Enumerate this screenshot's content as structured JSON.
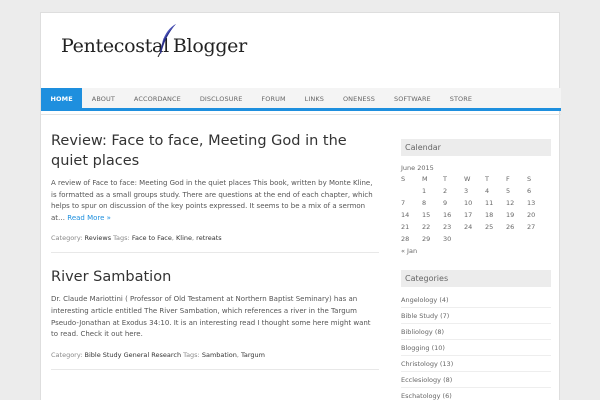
{
  "site": {
    "logo_text_left": "Pentecostal",
    "logo_text_right": "Blogger",
    "accent_color": "#1e8fde",
    "logo_icon": "quill-icon"
  },
  "nav": {
    "items": [
      {
        "label": "HOME"
      },
      {
        "label": "ABOUT"
      },
      {
        "label": "ACCORDANCE"
      },
      {
        "label": "DISCLOSURE"
      },
      {
        "label": "FORUM"
      },
      {
        "label": "LINKS"
      },
      {
        "label": "ONENESS"
      },
      {
        "label": "SOFTWARE"
      },
      {
        "label": "STORE"
      }
    ]
  },
  "posts": [
    {
      "title": "Review: Face to face, Meeting God in the quiet places",
      "excerpt": "A review of Face to face: Meeting God in the quiet places This book, written by Monte Kline, is formatted as a small groups study. There are questions at the end of each chapter, which helps to spur on discussion of the key points expressed. It seems to be a mix of a sermon at… ",
      "read_more": "Read More »",
      "category_label": "Category:",
      "categories": "Reviews",
      "tags_label": "Tags:",
      "tags": [
        "Face to Face",
        "Kline",
        "retreats"
      ]
    },
    {
      "title": "River Sambation",
      "excerpt": "Dr. Claude Mariottini ( Professor of Old Testament at Northern Baptist Seminary) has an interesting article entitled The River Sambation, which references a river in the Targum Pseudo-Jonathan at Exodus 34:10.  It is an interesting read I thought some here might want to read.  Check it out here.",
      "category_label": "Category:",
      "categories": "Bible Study  General  Research",
      "tags_label": "Tags:",
      "tags": [
        "Sambation",
        "Targum"
      ]
    }
  ],
  "sidebar": {
    "calendar": {
      "title": "Calendar",
      "caption": "June 2015",
      "days": [
        "S",
        "M",
        "T",
        "W",
        "T",
        "F",
        "S"
      ],
      "weeks": [
        [
          "",
          "1",
          "2",
          "3",
          "4",
          "5",
          "6"
        ],
        [
          "7",
          "8",
          "9",
          "10",
          "11",
          "12",
          "13"
        ],
        [
          "14",
          "15",
          "16",
          "17",
          "18",
          "19",
          "20"
        ],
        [
          "21",
          "22",
          "23",
          "24",
          "25",
          "26",
          "27"
        ],
        [
          "28",
          "29",
          "30",
          "",
          "",
          "",
          ""
        ]
      ],
      "prev": "« Jan"
    },
    "categories": {
      "title": "Categories",
      "items": [
        {
          "name": "Angelology",
          "count": "(4)"
        },
        {
          "name": "Bible Study",
          "count": "(7)"
        },
        {
          "name": "Bibliology",
          "count": "(8)"
        },
        {
          "name": "Blogging",
          "count": "(10)"
        },
        {
          "name": "Christology",
          "count": "(13)"
        },
        {
          "name": "Ecclesiology",
          "count": "(8)"
        },
        {
          "name": "Eschatology",
          "count": "(6)"
        }
      ]
    }
  }
}
